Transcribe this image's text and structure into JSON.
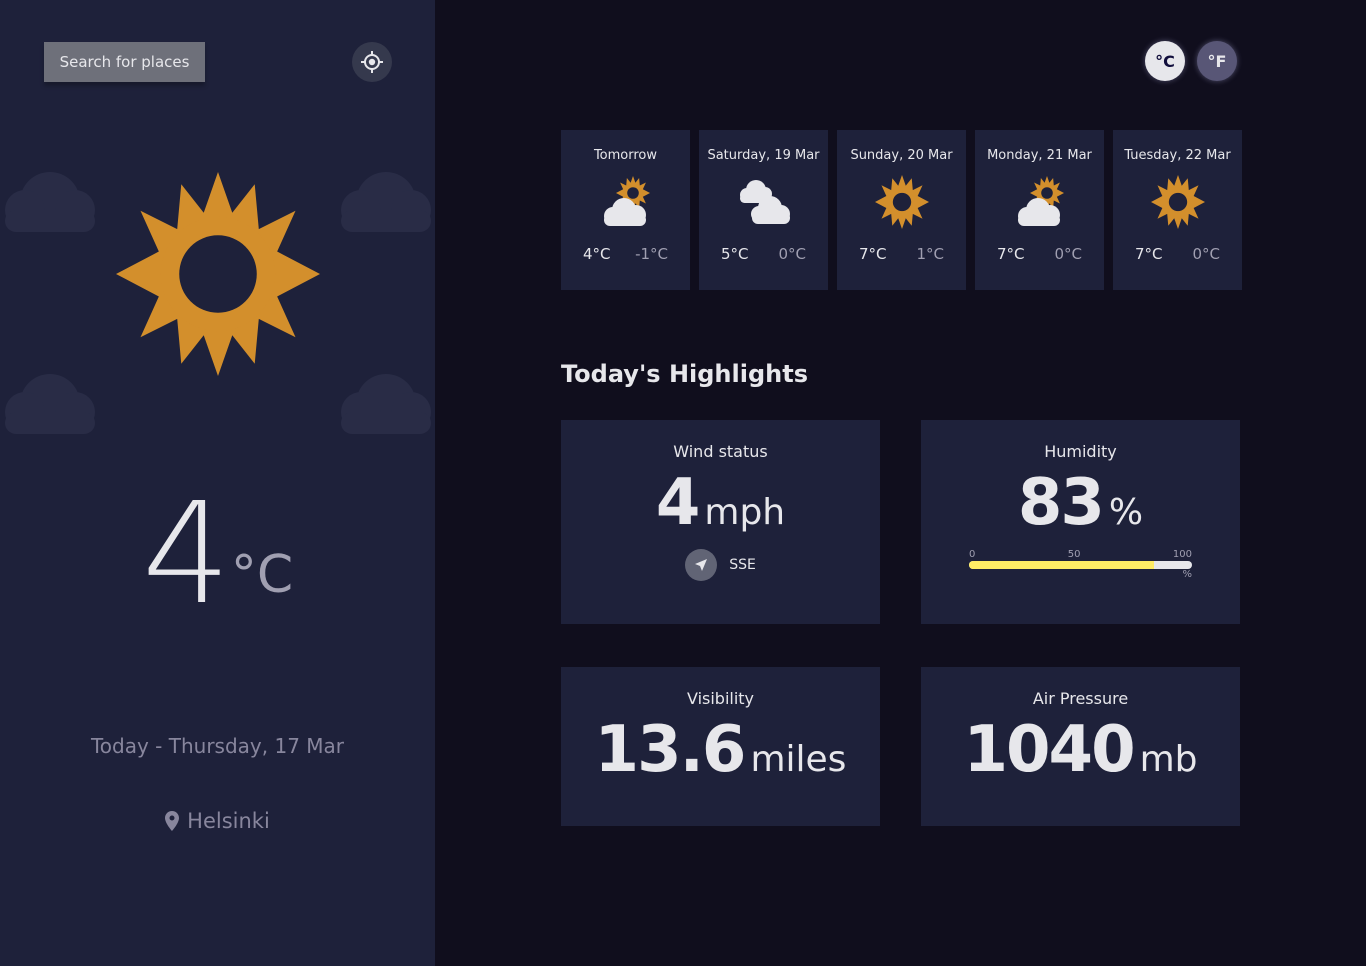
{
  "sidebar": {
    "search_label": "Search for places",
    "current": {
      "icon": "sun-icon",
      "temp": "4",
      "unit": "°C",
      "date": "Today - Thursday, 17 Mar",
      "location": "Helsinki"
    }
  },
  "units": {
    "celsius": "°C",
    "fahrenheit": "°F",
    "selected": "celsius"
  },
  "forecast": [
    {
      "day": "Tomorrow",
      "icon": "partly-cloudy-icon",
      "max": "4°C",
      "min": "-1°C"
    },
    {
      "day": "Saturday, 19 Mar",
      "icon": "cloudy-icon",
      "max": "5°C",
      "min": "0°C"
    },
    {
      "day": "Sunday, 20 Mar",
      "icon": "sun-icon",
      "max": "7°C",
      "min": "1°C"
    },
    {
      "day": "Monday, 21 Mar",
      "icon": "partly-cloudy-icon",
      "max": "7°C",
      "min": "0°C"
    },
    {
      "day": "Tuesday, 22 Mar",
      "icon": "sun-icon",
      "max": "7°C",
      "min": "0°C"
    }
  ],
  "highlights": {
    "title": "Today's Highlights",
    "wind": {
      "label": "Wind status",
      "value": "4",
      "unit": "mph",
      "direction": "SSE"
    },
    "humidity": {
      "label": "Humidity",
      "value": "83",
      "unit": "%",
      "fraction": 0.83,
      "tick_0": "0",
      "tick_50": "50",
      "tick_100": "100",
      "pct": "%"
    },
    "visibility": {
      "label": "Visibility",
      "value": "13.6",
      "unit": "miles"
    },
    "pressure": {
      "label": "Air Pressure",
      "value": "1040",
      "unit": "mb"
    }
  },
  "colors": {
    "sidebar_bg": "#1e213a",
    "page_bg": "#100e1d",
    "sun": "#d38f2c",
    "humidity_fill": "#ffec65"
  }
}
